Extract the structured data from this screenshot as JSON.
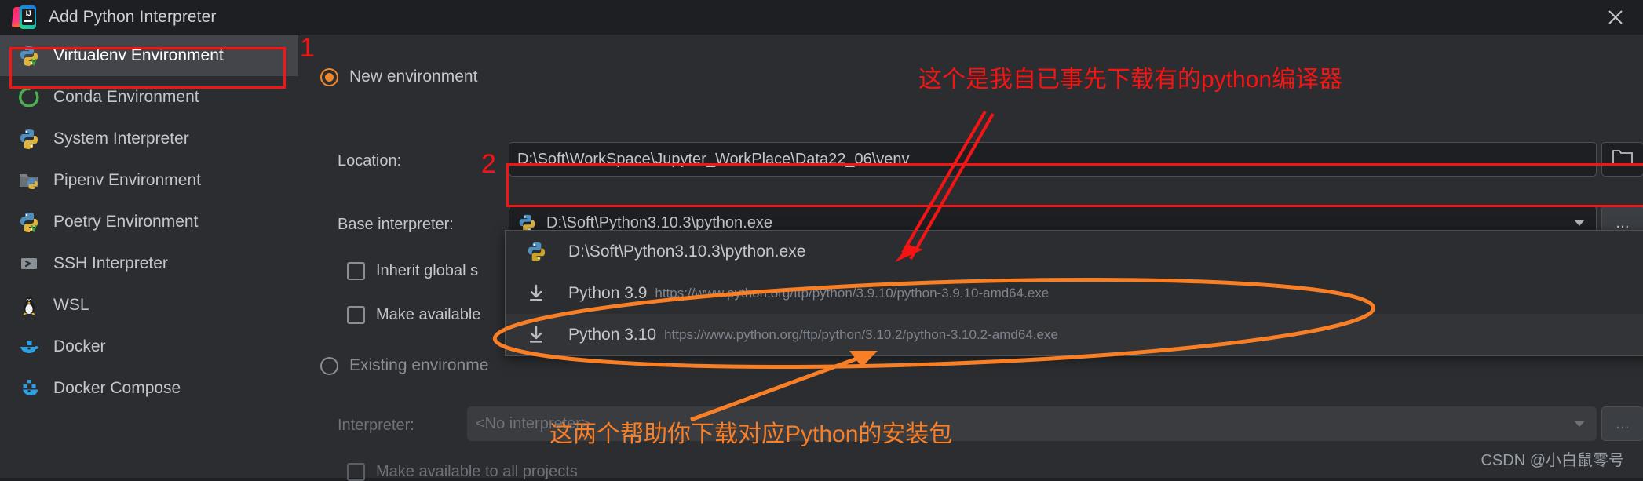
{
  "window": {
    "title": "Add Python Interpreter",
    "logo_icon": "intellij-idea-icon",
    "close_icon": "close-icon"
  },
  "sidebar": {
    "items": [
      {
        "label": "Virtualenv Environment",
        "icon": "python-venv-icon",
        "selected": true
      },
      {
        "label": "Conda Environment",
        "icon": "conda-icon",
        "selected": false
      },
      {
        "label": "System Interpreter",
        "icon": "python-icon",
        "selected": false
      },
      {
        "label": "Pipenv Environment",
        "icon": "pipenv-folder-icon",
        "selected": false
      },
      {
        "label": "Poetry Environment",
        "icon": "python-venv-icon",
        "selected": false
      },
      {
        "label": "SSH Interpreter",
        "icon": "ssh-terminal-icon",
        "selected": false
      },
      {
        "label": "WSL",
        "icon": "linux-penguin-icon",
        "selected": false
      },
      {
        "label": "Docker",
        "icon": "docker-whale-icon",
        "selected": false
      },
      {
        "label": "Docker Compose",
        "icon": "docker-compose-icon",
        "selected": false
      }
    ]
  },
  "main": {
    "new_environment": {
      "radio_label": "New environment",
      "selected": true,
      "location_label": "Location:",
      "location_value": "D:\\Soft\\WorkSpace\\Jupyter_WorkPlace\\Data22_06\\venv",
      "browse_icon": "folder-icon",
      "base_interpreter_label": "Base interpreter:",
      "base_interpreter_value": "D:\\Soft\\Python3.10.3\\python.exe",
      "base_interpreter_icon": "python-icon",
      "base_interpreter_more_label": "...",
      "inherit_global_label": "Inherit global s",
      "inherit_global_checked": false,
      "make_available_label": "Make available",
      "make_available_checked": false
    },
    "existing_environment": {
      "radio_label": "Existing environme",
      "selected": false,
      "interpreter_label": "Interpreter:",
      "interpreter_value": "<No interpreter>",
      "interpreter_more_label": "...",
      "make_available_label": "Make available to all projects",
      "make_available_checked": false
    },
    "dropdown": {
      "items": [
        {
          "icon": "python-icon",
          "name": "D:\\Soft\\Python3.10.3\\python.exe",
          "url": ""
        },
        {
          "icon": "download-icon",
          "name": "Python 3.9",
          "url": "https://www.python.org/ftp/python/3.9.10/python-3.9.10-amd64.exe"
        },
        {
          "icon": "download-icon",
          "name": "Python 3.10",
          "url": "https://www.python.org/ftp/python/3.10.2/python-3.10.2-amd64.exe"
        }
      ]
    }
  },
  "annotations": {
    "marker_one": "1",
    "marker_two": "2",
    "note_red": "这个是我自已事先下载有的python编译器",
    "note_orange": "这两个帮助你下载对应Python的安装包",
    "colors": {
      "red": "#f41414",
      "orange": "#f97f26",
      "accent": "#f0882a"
    }
  },
  "watermark": {
    "text": "CSDN @小白鼠零号"
  }
}
